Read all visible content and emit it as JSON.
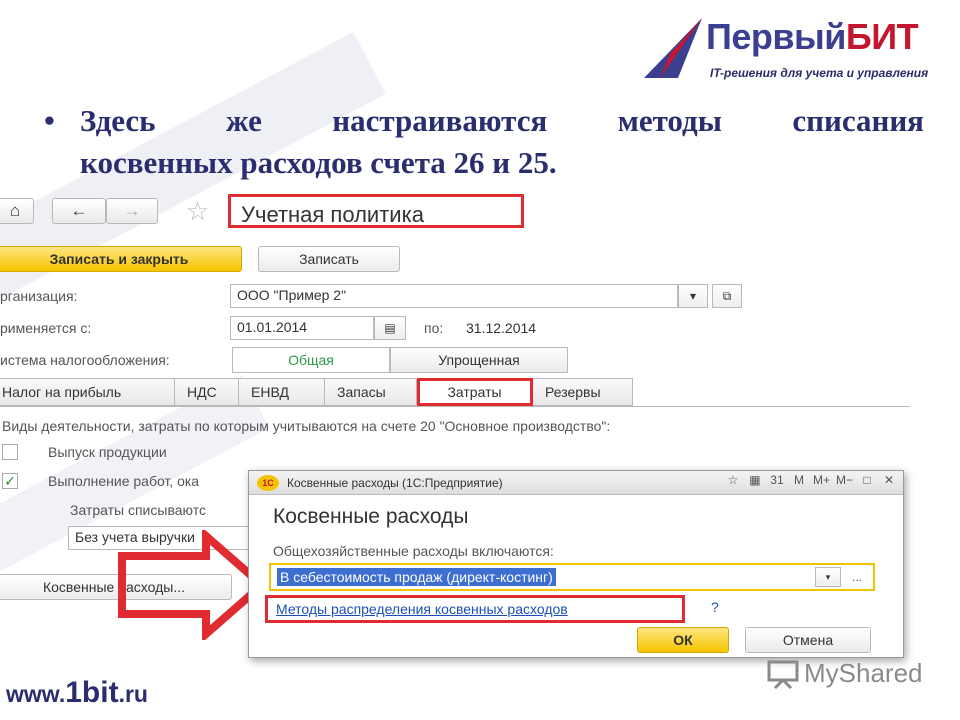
{
  "logo": {
    "name_part1": "Первый",
    "name_part2": "БИТ",
    "tagline": "IT-решения для учета и управления"
  },
  "heading": {
    "bullet": "•",
    "line1_words": [
      "Здесь",
      "же",
      "настраиваются",
      "методы",
      "списания"
    ],
    "line2": "косвенных расходов счета 26 и 25."
  },
  "window": {
    "nav": {
      "home": "⌂",
      "back": "←",
      "forward": "→",
      "star": "☆"
    },
    "title": "Учетная политика",
    "save_close_label": "Записать и закрыть",
    "save_label": "Записать",
    "org_label": "рганизация:",
    "org_value": "ООО \"Пример 2\"",
    "applies_label": "рименяется с:",
    "date_from": "01.01.2014",
    "to_label": "по:",
    "date_to": "31.12.2014",
    "tax_label": "истема налогообложения:",
    "tax_option_general": "Общая",
    "tax_option_simplified": "Упрощенная",
    "tabs": [
      "Налог на прибыль",
      "НДС",
      "ЕНВД",
      "Запасы",
      "Затраты",
      "Резервы"
    ],
    "activities_label": "Виды деятельности, затраты по которым учитываются на счете 20 \"Основное производство\":",
    "activity1": "Выпуск продукции",
    "activity2": "Выполнение работ, ока",
    "costs_label": "Затраты списываютс",
    "costs_value": "Без учета выручки",
    "indirect_button": "Косвенные расходы..."
  },
  "dialog": {
    "titlebar": "Косвенные расходы  (1С:Предприятие)",
    "app_badge": "1С",
    "tools": [
      "☆",
      "▦",
      "31",
      "M",
      "M+",
      "M−",
      "□",
      "✕"
    ],
    "heading": "Косвенные расходы",
    "field_label": "Общехозяйственные расходы включаются:",
    "field_value": "В себестоимость продаж (директ-костинг)",
    "dropdown_glyph": "▾",
    "dots": "...",
    "link": "Методы распределения косвенных расходов",
    "help": "?",
    "ok": "ОК",
    "cancel": "Отмена"
  },
  "footer": {
    "prefix": "www.",
    "mid": "1bit",
    "suffix": ".ru"
  },
  "watermark": "MyShared",
  "colors": {
    "brand_blue": "#2a2d6e",
    "brand_red": "#c4172f",
    "highlight_red": "#e02b31",
    "accent_yellow": "#f5c400"
  }
}
